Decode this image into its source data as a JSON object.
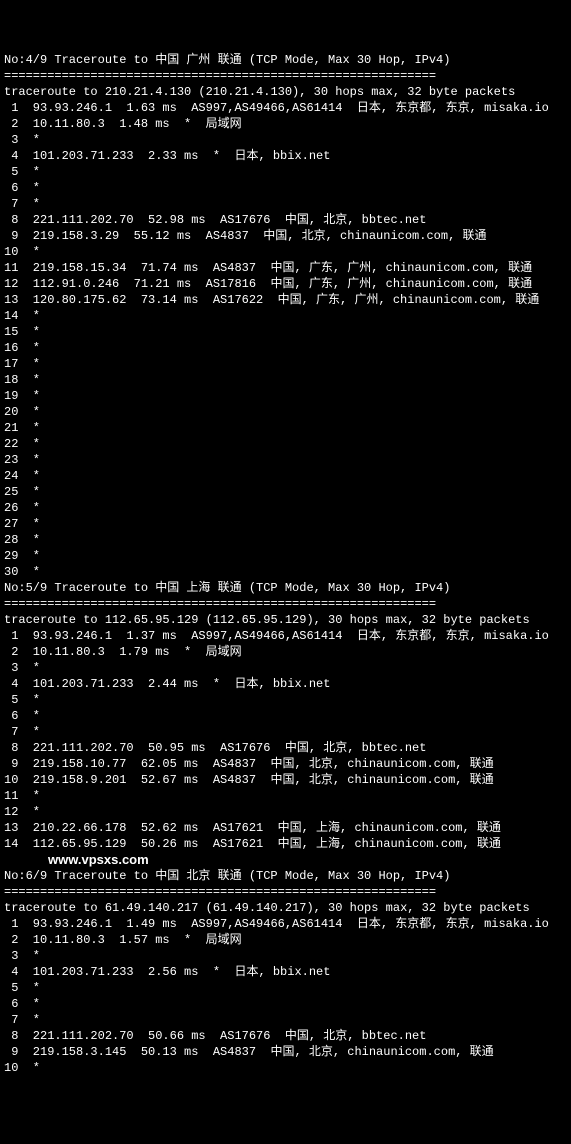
{
  "traces": [
    {
      "header": "No:4/9 Traceroute to 中国 广州 联通 (TCP Mode, Max 30 Hop, IPv4)",
      "sep": "============================================================",
      "cmd": "traceroute to 210.21.4.130 (210.21.4.130), 30 hops max, 32 byte packets",
      "hops": [
        " 1  93.93.246.1  1.63 ms  AS997,AS49466,AS61414  日本, 东京都, 东京, misaka.io",
        " 2  10.11.80.3  1.48 ms  *  局域网",
        " 3  *",
        " 4  101.203.71.233  2.33 ms  *  日本, bbix.net",
        " 5  *",
        " 6  *",
        " 7  *",
        " 8  221.111.202.70  52.98 ms  AS17676  中国, 北京, bbtec.net",
        " 9  219.158.3.29  55.12 ms  AS4837  中国, 北京, chinaunicom.com, 联通",
        "10  *",
        "11  219.158.15.34  71.74 ms  AS4837  中国, 广东, 广州, chinaunicom.com, 联通",
        "12  112.91.0.246  71.21 ms  AS17816  中国, 广东, 广州, chinaunicom.com, 联通",
        "13  120.80.175.62  73.14 ms  AS17622  中国, 广东, 广州, chinaunicom.com, 联通",
        "14  *",
        "15  *",
        "16  *",
        "17  *",
        "18  *",
        "19  *",
        "20  *",
        "21  *",
        "22  *",
        "23  *",
        "24  *",
        "25  *",
        "26  *",
        "27  *",
        "28  *",
        "29  *",
        "30  *"
      ]
    },
    {
      "header": "No:5/9 Traceroute to 中国 上海 联通 (TCP Mode, Max 30 Hop, IPv4)",
      "sep": "============================================================",
      "cmd": "traceroute to 112.65.95.129 (112.65.95.129), 30 hops max, 32 byte packets",
      "hops": [
        " 1  93.93.246.1  1.37 ms  AS997,AS49466,AS61414  日本, 东京都, 东京, misaka.io",
        " 2  10.11.80.3  1.79 ms  *  局域网",
        " 3  *",
        " 4  101.203.71.233  2.44 ms  *  日本, bbix.net",
        " 5  *",
        " 6  *",
        " 7  *",
        " 8  221.111.202.70  50.95 ms  AS17676  中国, 北京, bbtec.net",
        " 9  219.158.10.77  62.05 ms  AS4837  中国, 北京, chinaunicom.com, 联通",
        "10  219.158.9.201  52.67 ms  AS4837  中国, 北京, chinaunicom.com, 联通",
        "11  *",
        "12  *",
        "13  210.22.66.178  52.62 ms  AS17621  中国, 上海, chinaunicom.com, 联通",
        "14  112.65.95.129  50.26 ms  AS17621  中国, 上海, chinaunicom.com, 联通"
      ]
    },
    {
      "header": "No:6/9 Traceroute to 中国 北京 联通 (TCP Mode, Max 30 Hop, IPv4)",
      "sep": "============================================================",
      "cmd": "traceroute to 61.49.140.217 (61.49.140.217), 30 hops max, 32 byte packets",
      "hops": [
        " 1  93.93.246.1  1.49 ms  AS997,AS49466,AS61414  日本, 东京都, 东京, misaka.io",
        " 2  10.11.80.3  1.57 ms  *  局域网",
        " 3  *",
        " 4  101.203.71.233  2.56 ms  *  日本, bbix.net",
        " 5  *",
        " 6  *",
        " 7  *",
        " 8  221.111.202.70  50.66 ms  AS17676  中国, 北京, bbtec.net",
        " 9  219.158.3.145  50.13 ms  AS4837  中国, 北京, chinaunicom.com, 联通"
      ]
    }
  ],
  "watermark": "www.vpsxs.com"
}
